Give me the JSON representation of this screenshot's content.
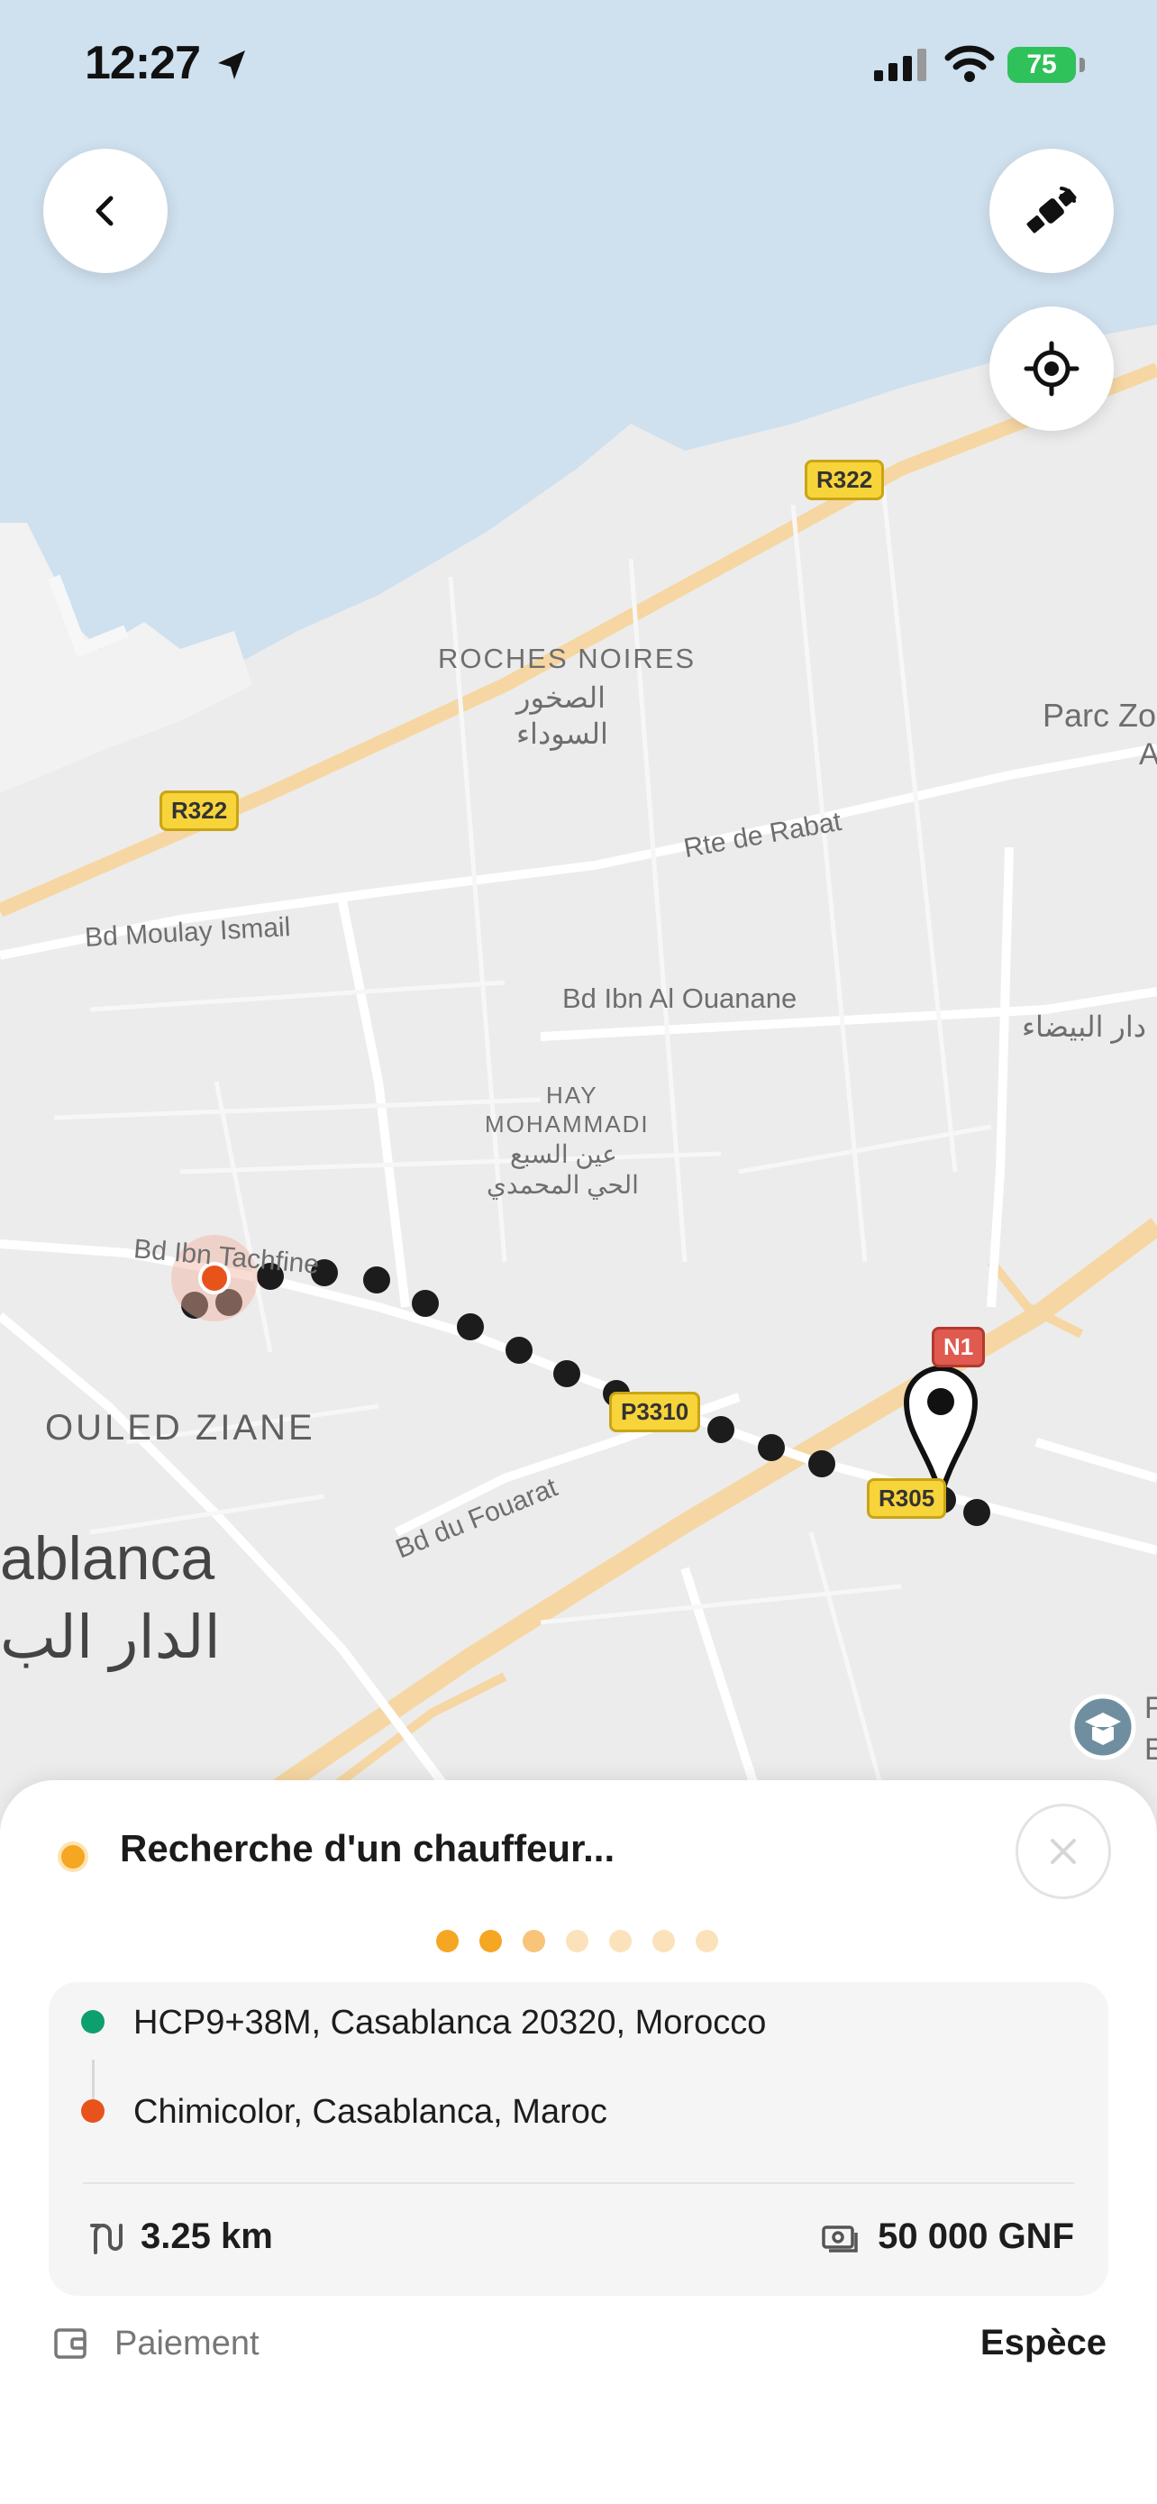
{
  "status_bar": {
    "time": "12:27",
    "battery": "75"
  },
  "map": {
    "places": {
      "roches_noires": "ROCHES NOIRES",
      "roches_noires_ar1": "الصخور",
      "roches_noires_ar2": "السوداء",
      "parc": "Parc Zo",
      "parc_a": "A",
      "hay1": "HAY",
      "hay2": "MOHAMMADI",
      "hay_ar1": "عين السبع",
      "hay_ar2": "الحي المحمدي",
      "ouled_ziane": "OULED ZIANE",
      "casablanca": "ablanca",
      "casablanca_ar": "الدار الب",
      "ar_right": "دار البيضاء",
      "rte_rabat": "Rte de Rabat",
      "moulay": "Bd Moulay Ismail",
      "ouanane": "Bd Ibn Al Ouanane",
      "tachfine": "Bd Ibn Tachfine",
      "fouarat": "Bd du Fouarat",
      "edge_f": "F",
      "edge_e": "E"
    },
    "road_badges": {
      "r322_top": "R322",
      "r322_left": "R322",
      "p3310": "P3310",
      "r305": "R305",
      "n1": "N1"
    }
  },
  "sheet": {
    "status_text": "Recherche d'un chauffeur...",
    "progress_dots": 7,
    "progress_active": 3,
    "pickup": "HCP9+38M, Casablanca 20320, Morocco",
    "dropoff": "Chimicolor, Casablanca, Maroc",
    "distance": "3.25 km",
    "price": "50 000 GNF",
    "payment_label": "Paiement",
    "payment_value": "Espèce"
  },
  "colors": {
    "pickup": "#0e9f6e",
    "dropoff": "#e8531c",
    "accent": "#f5a623",
    "water": "#cfe0ee"
  }
}
